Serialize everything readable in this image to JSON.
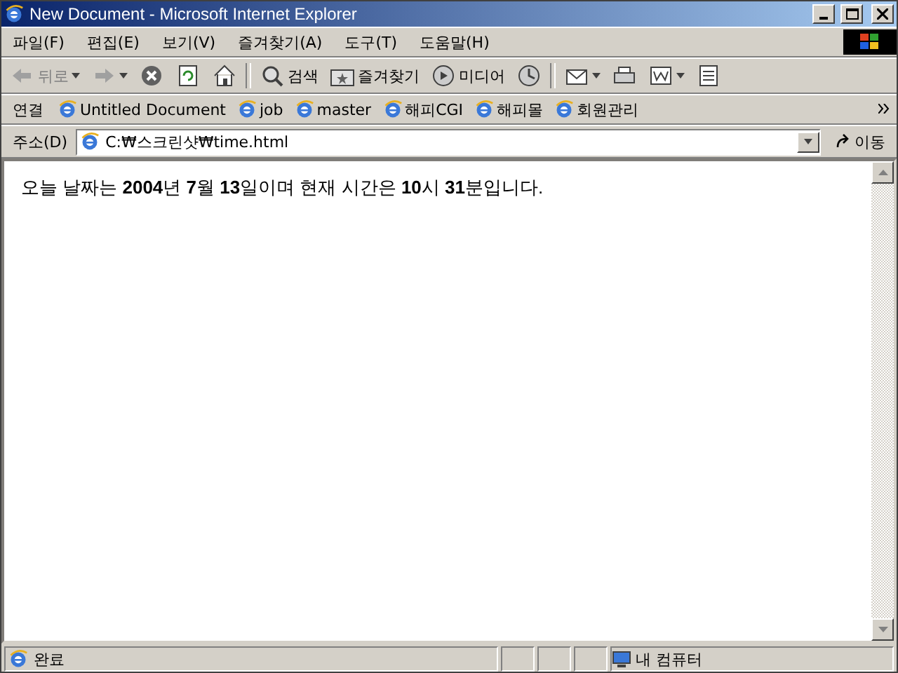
{
  "window": {
    "title": "New Document - Microsoft Internet Explorer"
  },
  "menu": [
    "파일(F)",
    "편집(E)",
    "보기(V)",
    "즐겨찾기(A)",
    "도구(T)",
    "도움말(H)"
  ],
  "toolbar": [
    {
      "kind": "back",
      "label": "뒤로",
      "disabled": true
    },
    {
      "kind": "forward",
      "disabled": true
    },
    {
      "kind": "stop"
    },
    {
      "kind": "refresh"
    },
    {
      "kind": "home"
    },
    {
      "kind": "sep"
    },
    {
      "kind": "search",
      "label": "검색"
    },
    {
      "kind": "favorites",
      "label": "즐겨찾기"
    },
    {
      "kind": "media",
      "label": "미디어"
    },
    {
      "kind": "history"
    },
    {
      "kind": "sep"
    },
    {
      "kind": "mail"
    },
    {
      "kind": "print"
    },
    {
      "kind": "edit"
    },
    {
      "kind": "discuss"
    }
  ],
  "links": {
    "label": "연결",
    "items": [
      "Untitled Document",
      "job",
      "master",
      "해피CGI",
      "해피몰",
      "회원관리"
    ]
  },
  "address": {
    "label": "주소(D)",
    "value": "C:₩스크린샷₩time.html",
    "go": "이동"
  },
  "content": "오늘 날짜는 **2004**년 **7**월 **13**일이며 현재 시간은 **10**시 **31**분입니다.",
  "status": {
    "text": "완료",
    "zone": "내 컴퓨터"
  }
}
